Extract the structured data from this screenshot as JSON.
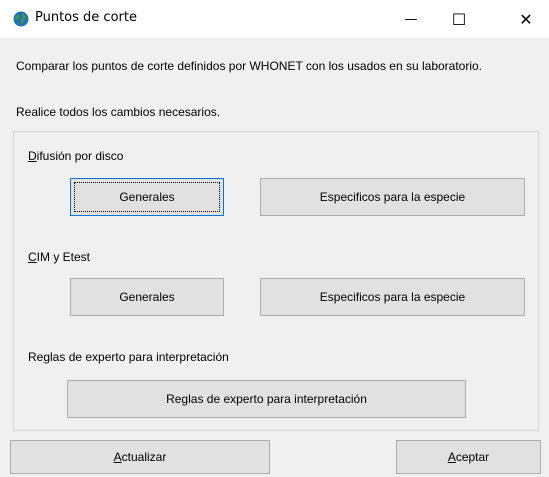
{
  "window": {
    "title": "Puntos de corte",
    "minimize_glyph": "—",
    "maximize_glyph": "☐",
    "close_glyph": "✕",
    "app_icon": "globe-icon"
  },
  "intro": {
    "line1": "Comparar los puntos de corte definidos por WHONET con los usados en su laboratorio.",
    "line2": "Realice todos los cambios necesarios."
  },
  "disk": {
    "label_mnemonic": "D",
    "label_rest": "ifusión por disco",
    "general_button": "Generales",
    "species_button": "Especificos para la especie"
  },
  "mic": {
    "label_mnemonic": "C",
    "label_rest": "IM y Etest",
    "general_button": "Generales",
    "species_button": "Especificos para la especie"
  },
  "expert": {
    "label": "Reglas de experto para interpretación",
    "button": "Reglas de experto para interpretación"
  },
  "footer": {
    "update_mnemonic": "A",
    "update_rest": "ctualizar",
    "accept_mnemonic": "A",
    "accept_rest": "ceptar"
  }
}
